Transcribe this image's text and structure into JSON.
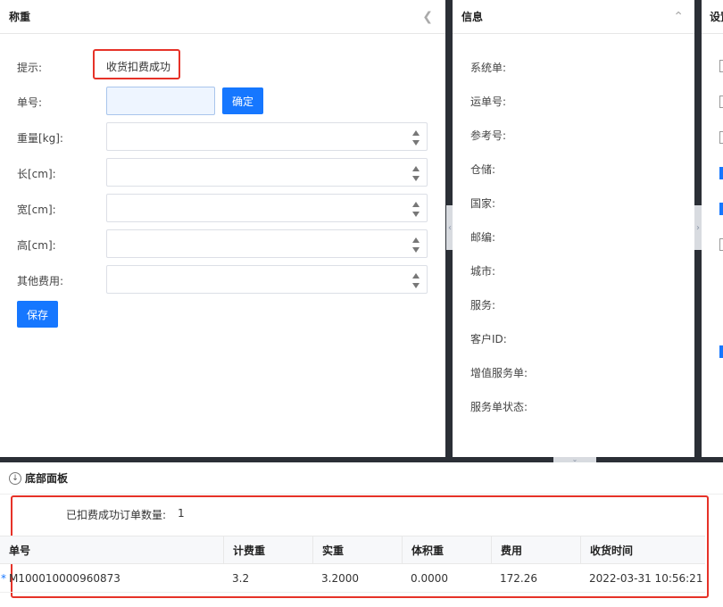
{
  "weigh_panel": {
    "title": "称重",
    "hint_label": "提示:",
    "hint_value": "收货扣费成功",
    "order_label": "单号:",
    "order_value": "",
    "confirm_label": "确定",
    "weight_label": "重量[kg]:",
    "length_label": "长[cm]:",
    "width_label": "宽[cm]:",
    "height_label": "高[cm]:",
    "other_fee_label": "其他费用:",
    "save_label": "保存"
  },
  "info_panel": {
    "title": "信息",
    "fields": [
      "系统单:",
      "运单号:",
      "参考号:",
      "仓储:",
      "国家:",
      "邮编:",
      "城市:",
      "服务:",
      "客户ID:",
      "增值服务单:",
      "服务单状态:"
    ]
  },
  "settings_panel": {
    "title": "设置",
    "checkboxes": [
      false,
      false,
      false,
      true,
      true,
      false,
      true
    ]
  },
  "bottom_panel": {
    "title": "底部面板",
    "count_label": "已扣费成功订单数量:",
    "count_value": "1",
    "columns": [
      "单号",
      "计费重",
      "实重",
      "体积重",
      "费用",
      "收货时间"
    ],
    "rows": [
      {
        "marker": "*",
        "order_no": "M100010000960873",
        "charge_weight": "3.2",
        "actual_weight": "3.2000",
        "volume_weight": "0.0000",
        "fee": "172.26",
        "receive_time": "2022-03-31 10:56:21"
      }
    ]
  },
  "colors": {
    "primary": "#1677ff",
    "highlight_red": "#e63228",
    "divider": "#2b2f36"
  }
}
